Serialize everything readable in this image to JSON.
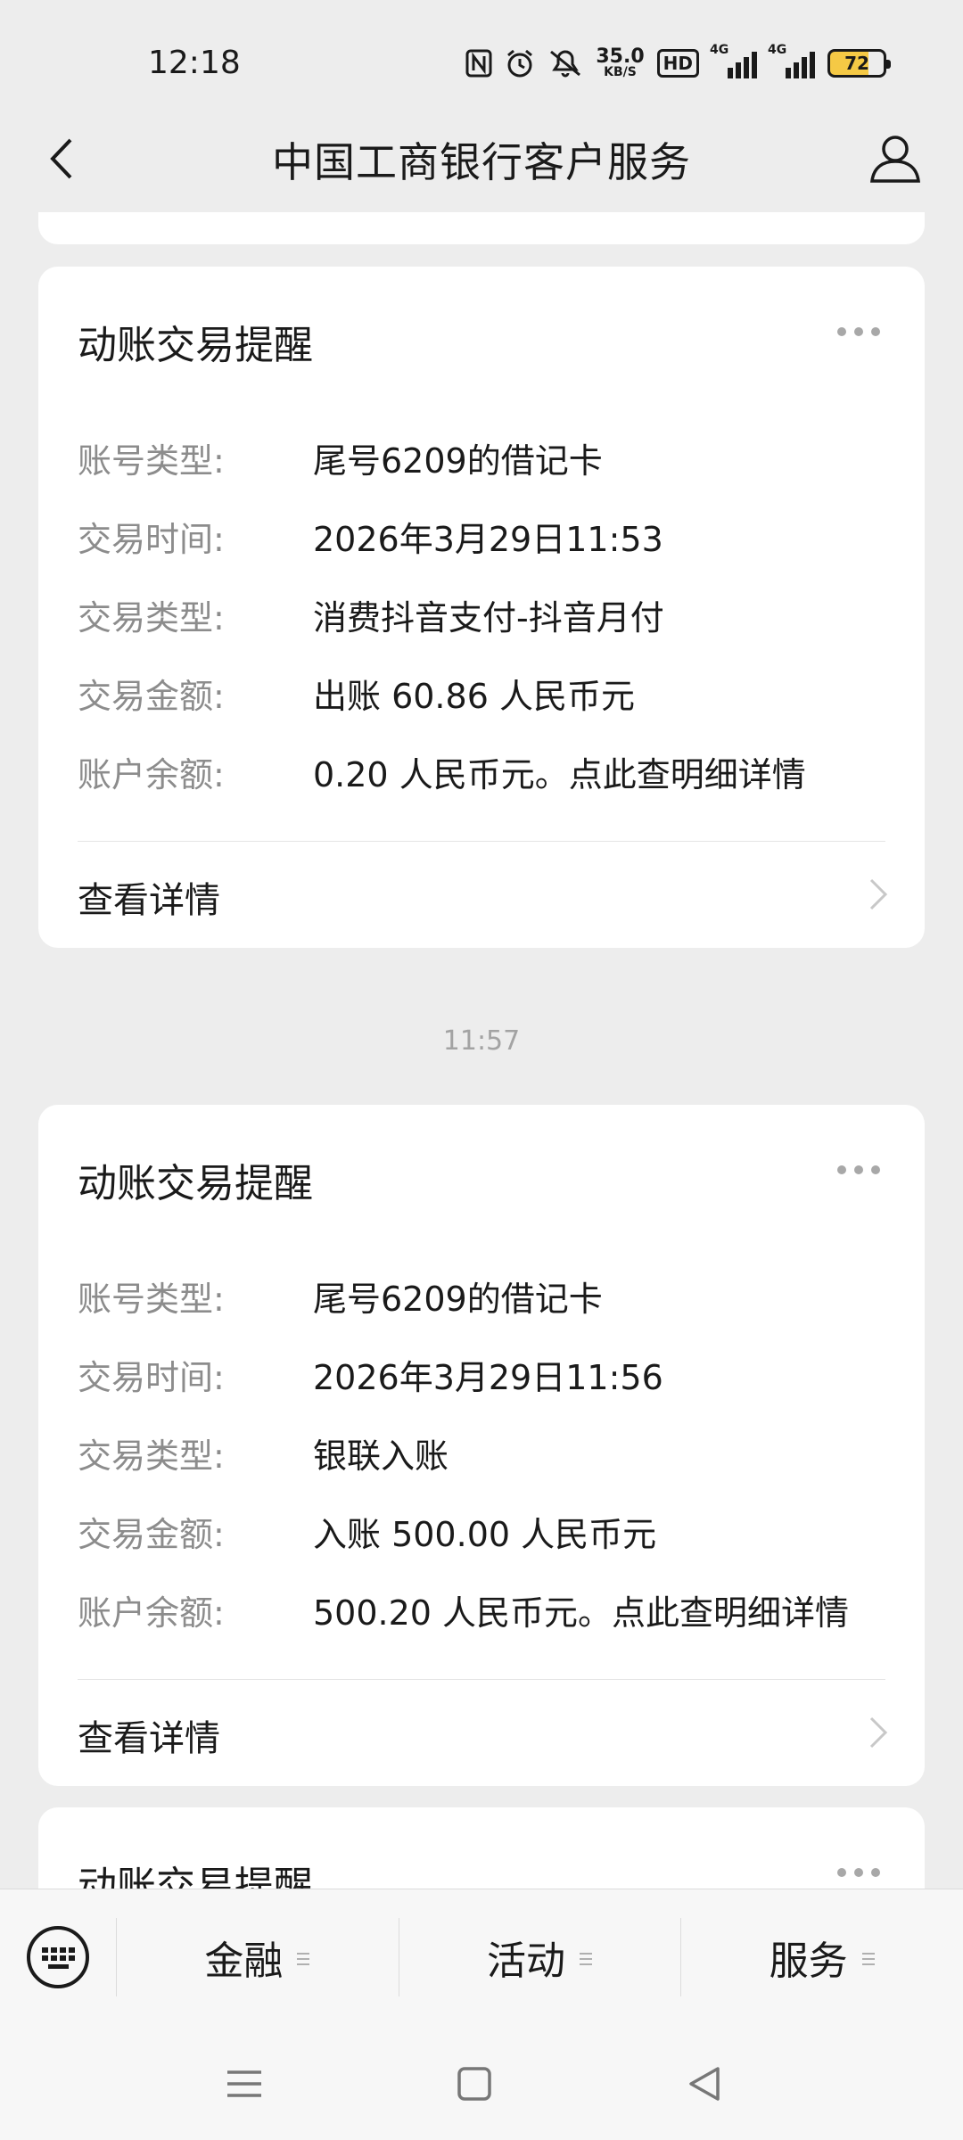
{
  "status_bar": {
    "time": "12:18",
    "net_speed_value": "35.0",
    "net_speed_unit": "KB/S",
    "hd_badge": "HD",
    "signal_1_label": "4G",
    "signal_2_label": "4G",
    "battery_level": "72"
  },
  "nav": {
    "title": "中国工商银行客户服务"
  },
  "messages": [
    {
      "title": "动账交易提醒",
      "fields": [
        {
          "label": "账号类型:",
          "value": "尾号6209的借记卡"
        },
        {
          "label": "交易时间:",
          "value": "2026年3月29日11:53"
        },
        {
          "label": "交易类型:",
          "value": "消费抖音支付-抖音月付"
        },
        {
          "label": "交易金额:",
          "value": "出账 60.86 人民币元"
        },
        {
          "label": "账户余额:",
          "value": "0.20 人民币元。点此查明细详情"
        }
      ],
      "link": "查看详情"
    },
    {
      "timestamp": "11:57",
      "title": "动账交易提醒",
      "fields": [
        {
          "label": "账号类型:",
          "value": "尾号6209的借记卡"
        },
        {
          "label": "交易时间:",
          "value": "2026年3月29日11:56"
        },
        {
          "label": "交易类型:",
          "value": "银联入账"
        },
        {
          "label": "交易金额:",
          "value": "入账 500.00 人民币元"
        },
        {
          "label": "账户余额:",
          "value": "500.20 人民币元。点此查明细详情"
        }
      ],
      "link": "查看详情"
    },
    {
      "title": "动账交易提醒"
    }
  ],
  "bottom_menu": {
    "items": [
      "金融",
      "活动",
      "服务"
    ]
  },
  "colors": {
    "background": "#ededed",
    "card": "#ffffff",
    "label_gray": "#8c8c8c",
    "battery_fill": "#f5c945"
  }
}
